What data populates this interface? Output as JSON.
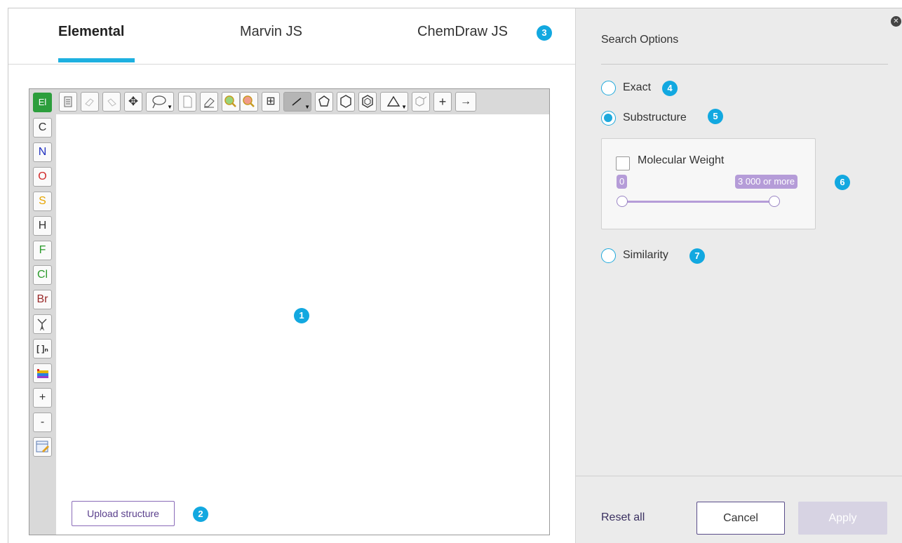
{
  "tabs": [
    {
      "label": "Elemental",
      "active": true
    },
    {
      "label": "Marvin JS",
      "active": false
    },
    {
      "label": "ChemDraw JS",
      "active": false
    }
  ],
  "callouts": [
    "1",
    "2",
    "3",
    "4",
    "5",
    "6",
    "7"
  ],
  "toolbar": {
    "element_button": "El",
    "top_icons": [
      "clipboard-icon",
      "undo-icon",
      "redo-icon",
      "move-icon",
      "lasso-icon",
      "new-document-icon",
      "eraser-icon",
      "zoom-in-icon",
      "zoom-out-icon",
      "clean-icon",
      "bond-icon",
      "pentagon-icon",
      "hexagon-icon",
      "benzene-icon",
      "triangle-icon",
      "template-icon",
      "plus-icon",
      "arrow-icon"
    ],
    "elements": [
      {
        "symbol": "C",
        "color": "#333333"
      },
      {
        "symbol": "N",
        "color": "#1f2fbf"
      },
      {
        "symbol": "O",
        "color": "#d12a2a"
      },
      {
        "symbol": "S",
        "color": "#e6a400"
      },
      {
        "symbol": "H",
        "color": "#333333"
      },
      {
        "symbol": "F",
        "color": "#2a9a2a"
      },
      {
        "symbol": "Cl",
        "color": "#2a9a2a"
      },
      {
        "symbol": "Br",
        "color": "#9a2a2a"
      }
    ],
    "extra_left": [
      "[ ]ₙ",
      "+",
      "-"
    ]
  },
  "upload": {
    "label": "Upload structure"
  },
  "search_options": {
    "title": "Search Options",
    "exact": "Exact",
    "substructure": "Substructure",
    "selected": "Substructure",
    "molecular_weight": {
      "label": "Molecular Weight",
      "checked": false,
      "min_label": "0",
      "max_label": "3 000 or more",
      "range": [
        0,
        3000
      ]
    },
    "similarity": "Similarity"
  },
  "footer": {
    "reset": "Reset all",
    "cancel": "Cancel",
    "apply": "Apply"
  },
  "colors": {
    "accent": "#1eb0e0",
    "slider": "#b59cd8",
    "primary": "#5a4d8a"
  }
}
